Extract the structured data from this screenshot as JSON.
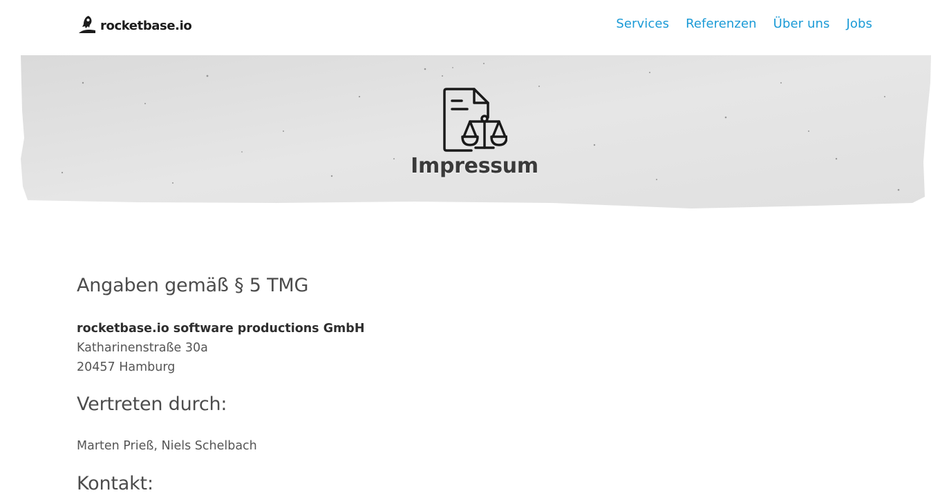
{
  "header": {
    "logo_text": "rocketbase.io",
    "logo_icon": "rocket-icon",
    "nav": [
      "Services",
      "Referenzen",
      "Über uns",
      "Jobs"
    ],
    "nav_color": "#1a9ad6"
  },
  "hero": {
    "icon": "legal-document-scales-icon",
    "title": "Impressum"
  },
  "sections": {
    "angaben": {
      "heading": "Angaben gemäß § 5 TMG",
      "company": "rocketbase.io software productions GmbH",
      "street": "Katharinenstraße 30a",
      "city": "20457 Hamburg"
    },
    "vertreten": {
      "heading": "Vertreten durch:",
      "names": "Marten Prieß, Niels Schelbach"
    },
    "kontakt": {
      "heading": "Kontakt:"
    }
  }
}
